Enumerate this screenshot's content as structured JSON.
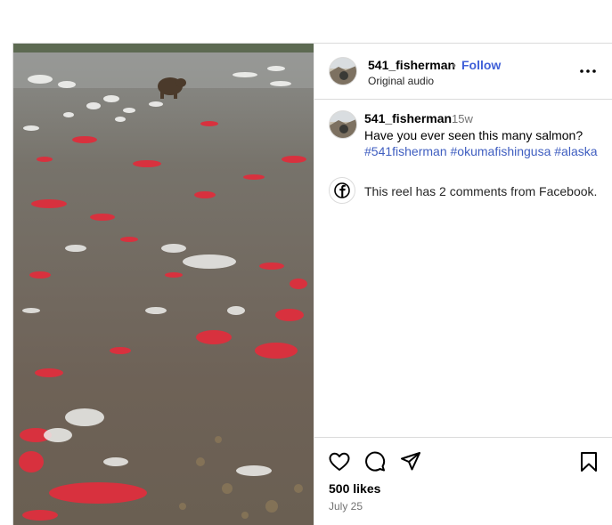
{
  "post": {
    "username": "541_fisherman",
    "separator": "•",
    "follow_label": "Follow",
    "audio": "Original audio",
    "more_icon": "more-options-icon"
  },
  "caption": {
    "username": "541_fisherman",
    "time_ago": "15w",
    "text": "Have you ever seen this many salmon?",
    "hashtags": [
      "#541fisherman",
      "#okumafishingusa",
      "#alaska"
    ]
  },
  "facebook": {
    "icon": "facebook-icon",
    "text": "This reel has 2 comments from Facebook."
  },
  "actions": {
    "icons": [
      "heart-icon",
      "comment-icon",
      "share-icon",
      "bookmark-icon"
    ],
    "likes": "500 likes",
    "date": "July 25"
  },
  "colors": {
    "link": "#4060d8",
    "hashtag": "#3f5ec0",
    "salmon": "#d8313e",
    "water": "#6f6d64",
    "secondary_text": "#737373",
    "border": "#dbdbdb"
  }
}
